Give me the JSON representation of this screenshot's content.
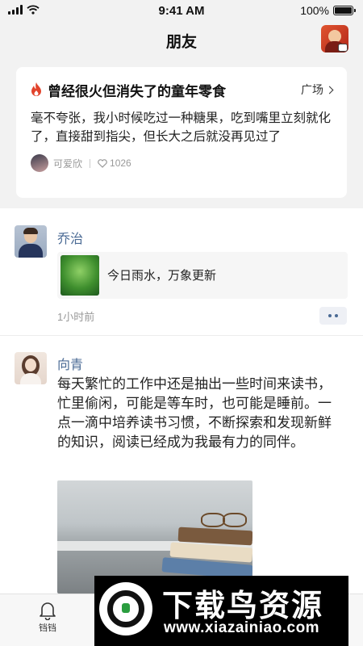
{
  "status_bar": {
    "time": "9:41 AM",
    "battery": "100%",
    "battery_level": 1.0
  },
  "nav": {
    "title": "朋友",
    "avatar_icon": "profile-camera-icon"
  },
  "hot_topic": {
    "icon": "fire-icon",
    "title": "曾经很火但消失了的童年零食",
    "link_label": "广场",
    "body": "毫不夸张，我小时候吃过一种糖果，吃到嘴里立刻就化了，直接甜到指尖，但长大之后就没再见过了",
    "author": "可爱欣",
    "likes": "1026"
  },
  "posts": [
    {
      "name": "乔治",
      "link_text": "今日雨水，万象更新",
      "time": "1小时前"
    },
    {
      "name": "向青",
      "text": "每天繁忙的工作中还是抽出一些时间来读书，忙里偷闲，可能是等车时，也可能是睡前。一点一滴中培养读书习惯，不断探索和发现新鲜的知识，阅读已经成为我最有力的同伴。"
    }
  ],
  "tab_bar": {
    "items": [
      {
        "label": "铛铛",
        "icon": "bell-icon"
      }
    ]
  },
  "watermark": {
    "title": "下载鸟资源",
    "url": "www.xiazainiao.com"
  },
  "colors": {
    "accent_blue": "#4a6a94",
    "fire": "#e2432b"
  }
}
